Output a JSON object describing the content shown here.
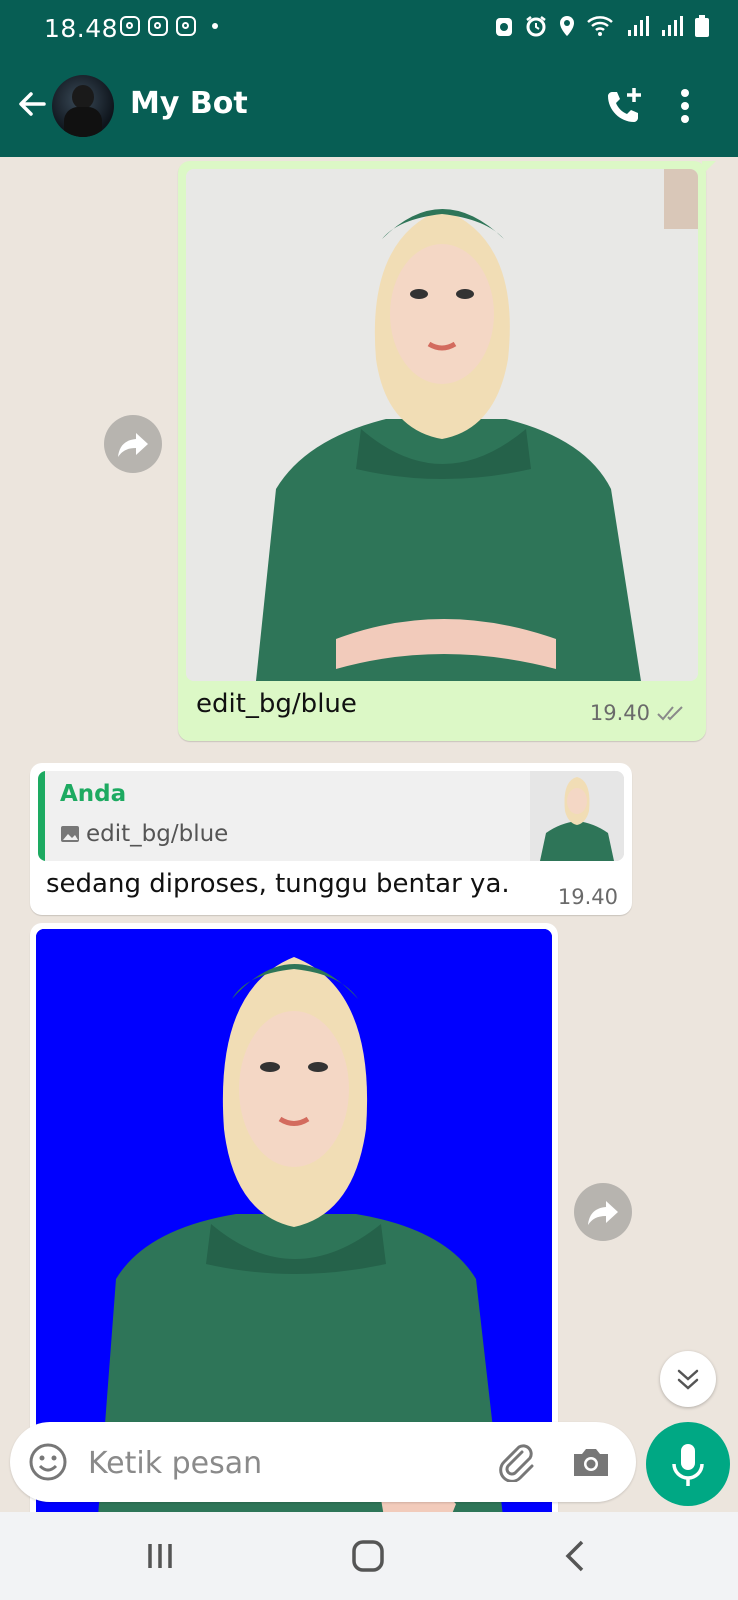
{
  "status_bar": {
    "time": "18.48"
  },
  "header": {
    "title": "My Bot"
  },
  "messages": {
    "outgoing_caption": "edit_bg/blue",
    "outgoing_time": "19.40",
    "reply_quote_name": "Anda",
    "reply_quote_text": "edit_bg/blue",
    "reply_text": "sedang diproses, tunggu bentar ya.",
    "reply_time": "19.40"
  },
  "input": {
    "placeholder": "Ketik pesan"
  },
  "colors": {
    "header": "#075e54",
    "outgoing_bubble": "#dcf8c6",
    "accent_green": "#1daa61",
    "mic_button": "#00a884",
    "blue_background": "#0000ff"
  },
  "icons": [
    "back-arrow-icon",
    "call-add-icon",
    "more-vert-icon",
    "forward-icon",
    "double-check-icon",
    "image-icon",
    "chevron-double-down-icon",
    "emoji-icon",
    "paperclip-icon",
    "camera-icon",
    "mic-icon",
    "recent-apps-icon",
    "home-icon",
    "back-nav-icon"
  ]
}
